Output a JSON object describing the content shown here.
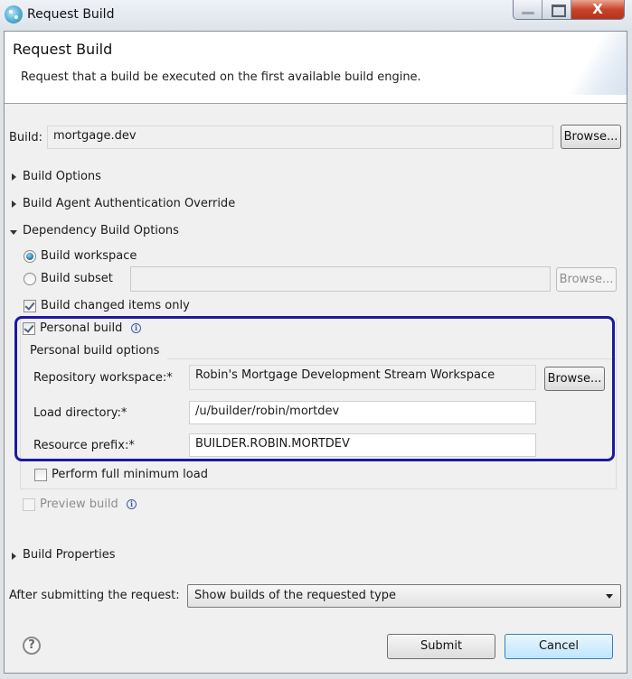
{
  "window": {
    "title": "Request Build",
    "controls": {
      "minimize": "minimize",
      "maximize": "maximize",
      "close": "X"
    }
  },
  "header": {
    "title": "Request Build",
    "description": "Request that a build be executed on the first available build engine."
  },
  "build": {
    "label": "Build:",
    "value": "mortgage.dev",
    "browse_label": "Browse..."
  },
  "sections": {
    "build_options": {
      "label": "Build Options",
      "expanded": false
    },
    "agent_auth": {
      "label": "Build Agent Authentication Override",
      "expanded": false
    },
    "dependency": {
      "label": "Dependency Build Options",
      "expanded": true
    },
    "build_properties": {
      "label": "Build Properties",
      "expanded": false
    }
  },
  "dependency_options": {
    "build_workspace": {
      "label": "Build workspace",
      "selected": true
    },
    "build_subset": {
      "label": "Build subset",
      "selected": false,
      "value": "",
      "browse_label": "Browse..."
    },
    "build_changed_only": {
      "label": "Build changed items only",
      "checked": true
    },
    "personal_build": {
      "label": "Personal build",
      "checked": true,
      "info_icon": "i"
    },
    "personal_build_options": {
      "group_label": "Personal build options",
      "repository_workspace": {
        "label": "Repository workspace:*",
        "value": "Robin's Mortgage Development Stream Workspace",
        "browse_label": "Browse..."
      },
      "load_directory": {
        "label": "Load directory:*",
        "value": "/u/builder/robin/mortdev"
      },
      "resource_prefix": {
        "label": "Resource prefix:*",
        "value": "BUILDER.ROBIN.MORTDEV"
      }
    },
    "full_minimum_load": {
      "label": "Perform full minimum load",
      "checked": false
    },
    "preview_build": {
      "label": "Preview build",
      "checked": false,
      "enabled": false,
      "info_icon": "i"
    }
  },
  "after_submit": {
    "label": "After submitting the request:",
    "selected": "Show builds of the requested type"
  },
  "footer": {
    "help_icon": "?",
    "submit_label": "Submit",
    "cancel_label": "Cancel"
  },
  "colors": {
    "highlight_border": "#1a1aa3",
    "close_button": "#c8432a",
    "default_button": "#bee6fd"
  }
}
